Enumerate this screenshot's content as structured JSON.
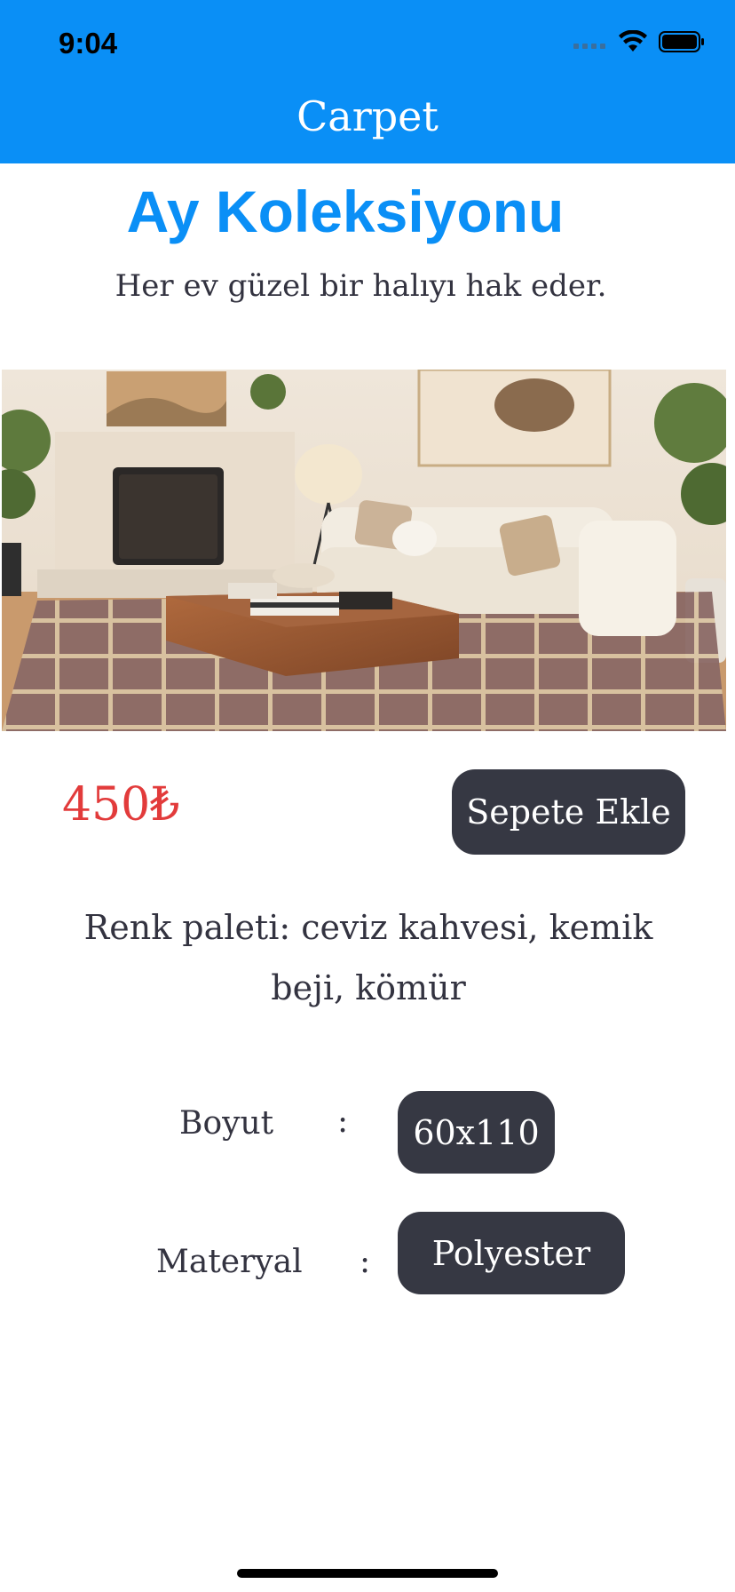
{
  "status_bar": {
    "time": "9:04",
    "icons": [
      "cellular-signal-icon",
      "wifi-icon",
      "battery-icon"
    ]
  },
  "nav": {
    "title": "Carpet"
  },
  "product": {
    "collection_title": "Ay Koleksiyonu",
    "tagline": "Her ev güzel bir halıyı hak eder.",
    "image": "living-room-carpet-photo",
    "price": "450₺",
    "add_to_cart_label": "Sepete Ekle",
    "palette_text": "Renk paleti: ceviz kahvesi, kemik beji, kömür",
    "specs": {
      "size_label": "Boyut",
      "size_colon": ":",
      "size_value": "60x110",
      "material_label": "Materyal",
      "material_colon": ":",
      "material_value": "Polyester"
    }
  },
  "colors": {
    "header_bg": "#0a8ff6",
    "headline": "#0a8ff6",
    "price": "#e23b3b",
    "button_bg": "#363843",
    "text": "#333340"
  }
}
